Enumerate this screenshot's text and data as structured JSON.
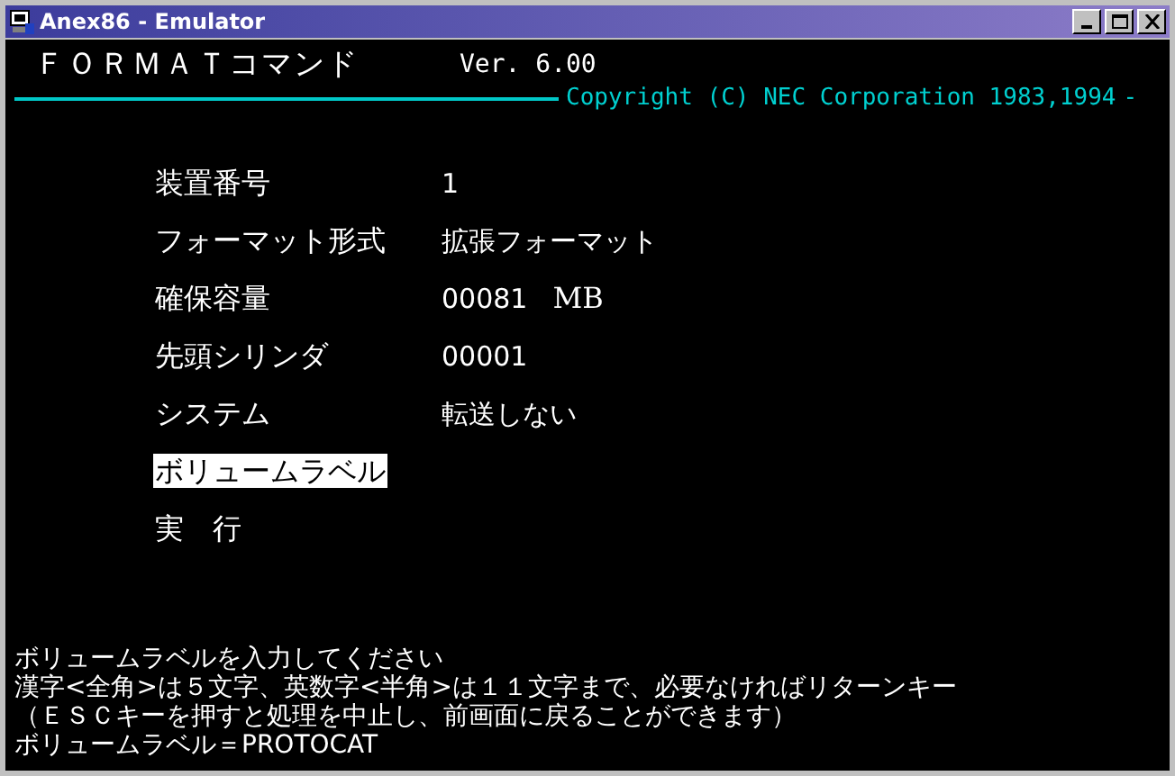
{
  "window": {
    "title": "Anex86 - Emulator"
  },
  "header": {
    "title": "ＦＯＲＭＡＴコマンド",
    "version": "Ver. 6.00",
    "copyright": "Copyright (C) NEC Corporation 1983,1994",
    "trail": "-"
  },
  "items": [
    {
      "label": "装置番号",
      "value": "1",
      "selected": false
    },
    {
      "label": "フォーマット形式",
      "value": "拡張フォーマット",
      "selected": false
    },
    {
      "label": "確保容量",
      "value": "00081",
      "unit": "MB",
      "selected": false
    },
    {
      "label": "先頭シリンダ",
      "value": "00001",
      "selected": false
    },
    {
      "label": "システム",
      "value": "転送しない",
      "selected": false
    },
    {
      "label": "ボリュームラベル",
      "selected": true
    },
    {
      "label": "実　行",
      "selected": false
    }
  ],
  "messages": [
    "ボリュームラベルを入力してください",
    "漢字<全角>は５文字、英数字<半角>は１１文字まで、必要なければリターンキー",
    "（ＥＳＣキーを押すと処理を中止し、前画面に戻ることができます）",
    "ボリュームラベル＝PROTOCAT"
  ]
}
